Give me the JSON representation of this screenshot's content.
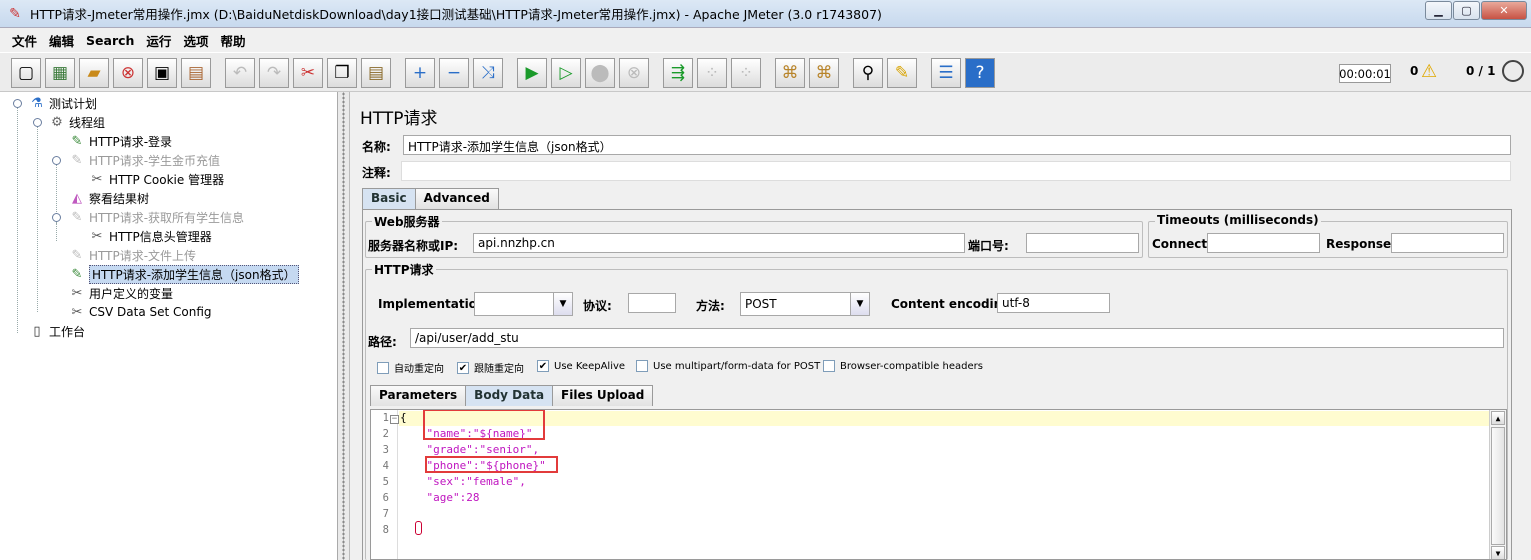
{
  "window": {
    "title": "HTTP请求-Jmeter常用操作.jmx (D:\\BaiduNetdiskDownload\\day1接口测试基础\\HTTP请求-Jmeter常用操作.jmx) - Apache JMeter (3.0 r1743807)",
    "controls": [
      "minimize",
      "maximize",
      "close"
    ]
  },
  "menu": [
    "文件",
    "编辑",
    "Search",
    "运行",
    "选项",
    "帮助"
  ],
  "toolbar": {
    "buttons": [
      "new-icon",
      "templates-icon",
      "open-icon",
      "close-icon",
      "save-icon",
      "save-as-icon",
      "undo-icon",
      "redo-icon",
      "cut-icon",
      "copy-icon",
      "paste-icon",
      "expand-icon",
      "collapse-icon",
      "toggle-icon",
      "start-icon",
      "start-no-timers-icon",
      "stop-icon",
      "shutdown-icon",
      "remote-start-icon",
      "remote-stop-icon",
      "remote-shutdown-icon",
      "clear-icon",
      "clear-all-icon",
      "search-icon",
      "reset-search-icon",
      "function-helper-icon",
      "help-icon"
    ],
    "timer": "00:00:01",
    "warnings": "0",
    "threads": "0 / 1"
  },
  "tree": [
    {
      "label": "测试计划",
      "icon": "test-plan-icon",
      "disabled": false,
      "selected": false
    },
    {
      "label": "线程组",
      "icon": "thread-group-icon",
      "disabled": false,
      "selected": false
    },
    {
      "label": "HTTP请求-登录",
      "icon": "sampler-icon",
      "disabled": false,
      "selected": false
    },
    {
      "label": "HTTP请求-学生金币充值",
      "icon": "sampler-icon",
      "disabled": true,
      "selected": false
    },
    {
      "label": "HTTP Cookie 管理器",
      "icon": "config-icon",
      "disabled": false,
      "selected": false
    },
    {
      "label": "察看结果树",
      "icon": "listener-icon",
      "disabled": false,
      "selected": false
    },
    {
      "label": "HTTP请求-获取所有学生信息",
      "icon": "sampler-icon",
      "disabled": true,
      "selected": false
    },
    {
      "label": "HTTP信息头管理器",
      "icon": "config-icon",
      "disabled": false,
      "selected": false
    },
    {
      "label": "HTTP请求-文件上传",
      "icon": "sampler-icon",
      "disabled": true,
      "selected": false
    },
    {
      "label": "HTTP请求-添加学生信息（json格式）",
      "icon": "sampler-icon",
      "disabled": false,
      "selected": true
    },
    {
      "label": "用户定义的变量",
      "icon": "config-icon",
      "disabled": false,
      "selected": false
    },
    {
      "label": "CSV Data Set Config",
      "icon": "config-icon",
      "disabled": false,
      "selected": false
    },
    {
      "label": "工作台",
      "icon": "workbench-icon",
      "disabled": false,
      "selected": false
    }
  ],
  "panel": {
    "heading": "HTTP请求",
    "name_label": "名称:",
    "name_value": "HTTP请求-添加学生信息（json格式）",
    "comment_label": "注释:",
    "comment_value": "",
    "tabs": [
      "Basic",
      "Advanced"
    ],
    "active_tab": "Basic",
    "web_server": {
      "title": "Web服务器",
      "server_label": "服务器名称或IP:",
      "server_value": "api.nnzhp.cn",
      "port_label": "端口号:",
      "port_value": ""
    },
    "timeouts": {
      "title": "Timeouts (milliseconds)",
      "connect_label": "Connect:",
      "connect_value": "",
      "response_label": "Response:",
      "response_value": ""
    },
    "http_request": {
      "title": "HTTP请求",
      "impl_label": "Implementation:",
      "impl_value": "",
      "protocol_label": "协议:",
      "protocol_value": "",
      "method_label": "方法:",
      "method_value": "POST",
      "encoding_label": "Content encoding:",
      "encoding_value": "utf-8",
      "path_label": "路径:",
      "path_value": "/api/user/add_stu"
    },
    "checkboxes": [
      {
        "label": "自动重定向",
        "checked": false
      },
      {
        "label": "跟随重定向",
        "checked": true
      },
      {
        "label": "Use KeepAlive",
        "checked": true
      },
      {
        "label": "Use multipart/form-data for POST",
        "checked": false
      },
      {
        "label": "Browser-compatible headers",
        "checked": false
      }
    ],
    "subtabs": [
      "Parameters",
      "Body Data",
      "Files Upload"
    ],
    "active_subtab": "Body Data",
    "body_lines": [
      "1",
      "2",
      "3",
      "4",
      "5",
      "6",
      "7",
      "8"
    ],
    "body_code": [
      "{",
      "    \"name\":\"${name}\"",
      "    \"grade\":\"senior\",",
      "    \"phone\":\"${phone}\"",
      "    \"sex\":\"female\",",
      "    \"age\":28",
      "",
      ""
    ]
  },
  "colors": {
    "title_gradient_top": "#dce8f5",
    "selected_node": "#c5d9f1",
    "json_string": "#c015c0",
    "highlight_box": "#e23b3b",
    "current_line": "#fffcd0"
  }
}
